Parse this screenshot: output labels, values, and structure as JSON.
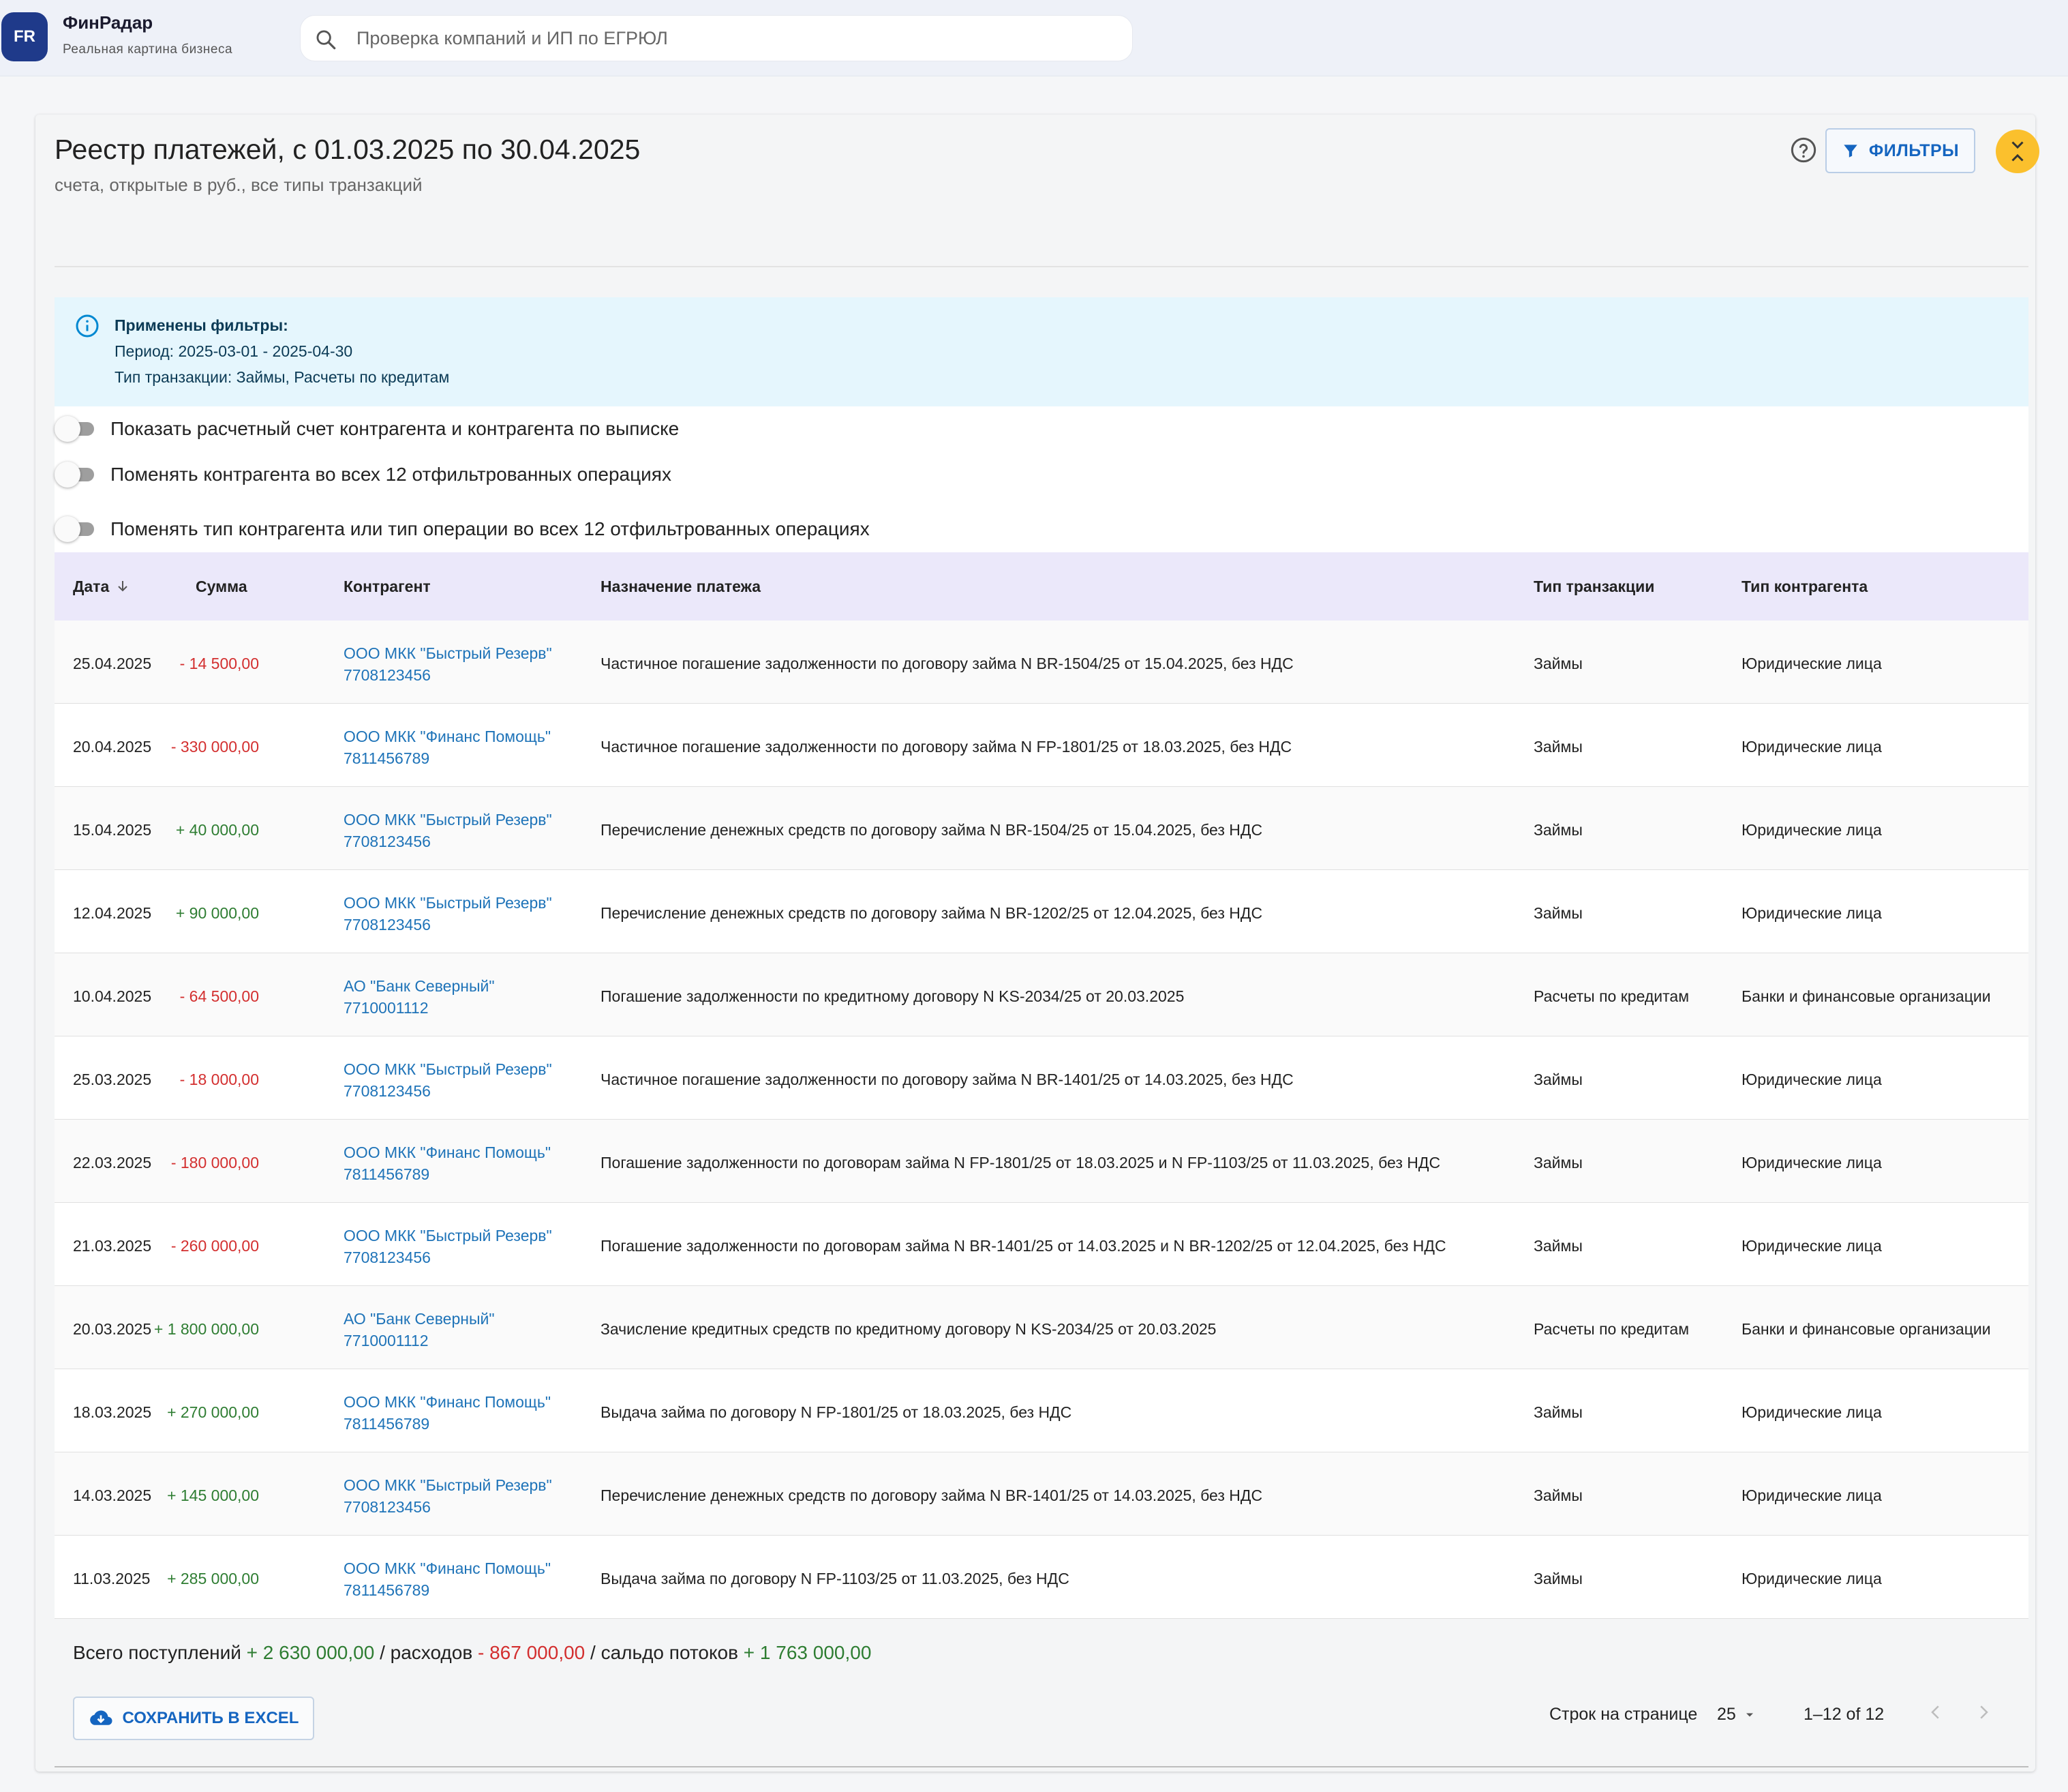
{
  "app": {
    "logo_text": "FR",
    "name": "ФинРадар",
    "tagline": "Реальная картина бизнеса"
  },
  "search": {
    "placeholder": "Проверка компаний и ИП по ЕГРЮЛ",
    "value": ""
  },
  "page": {
    "title": "Реестр платежей, с 01.03.2025 по 30.04.2025",
    "subtitle": "счета, открытые в руб., все типы транзакций",
    "filters_button": "ФИЛЬТРЫ"
  },
  "alert": {
    "title": "Применены фильтры:",
    "period": "Период: 2025-03-01 - 2025-04-30",
    "tx_types": "Тип транзакции: Займы, Расчеты по кредитам"
  },
  "toggles": [
    {
      "label": "Показать расчетный счет контрагента и контрагента по выписке",
      "on": false
    },
    {
      "label": "Поменять контрагента во всех 12 отфильтрованных операциях",
      "on": false
    },
    {
      "label": "Поменять тип контрагента или тип операции во всех 12 отфильтрованных операциях",
      "on": false
    }
  ],
  "table": {
    "columns": [
      "Дата",
      "Сумма",
      "Контрагент",
      "Назначение платежа",
      "Тип транзакции",
      "Тип контрагента"
    ],
    "rows": [
      {
        "date": "25.04.2025",
        "amount": "- 14 500,00",
        "sign": "neg",
        "cp_name": "ООО МКК \"Быстрый Резерв\"",
        "cp_inn": "7708123456",
        "purpose": "Частичное погашение задолженности по договору займа N BR-1504/25 от 15.04.2025, без НДС",
        "tx_type": "Займы",
        "cp_type": "Юридические лица"
      },
      {
        "date": "20.04.2025",
        "amount": "- 330 000,00",
        "sign": "neg",
        "cp_name": "ООО МКК \"Финанс Помощь\"",
        "cp_inn": "7811456789",
        "purpose": "Частичное погашение задолженности по договору займа N FP-1801/25 от 18.03.2025, без НДС",
        "tx_type": "Займы",
        "cp_type": "Юридические лица"
      },
      {
        "date": "15.04.2025",
        "amount": "+ 40 000,00",
        "sign": "pos",
        "cp_name": "ООО МКК \"Быстрый Резерв\"",
        "cp_inn": "7708123456",
        "purpose": "Перечисление денежных средств по договору займа N BR-1504/25 от 15.04.2025, без НДС",
        "tx_type": "Займы",
        "cp_type": "Юридические лица"
      },
      {
        "date": "12.04.2025",
        "amount": "+ 90 000,00",
        "sign": "pos",
        "cp_name": "ООО МКК \"Быстрый Резерв\"",
        "cp_inn": "7708123456",
        "purpose": "Перечисление денежных средств по договору займа N BR-1202/25 от 12.04.2025, без НДС",
        "tx_type": "Займы",
        "cp_type": "Юридические лица"
      },
      {
        "date": "10.04.2025",
        "amount": "- 64 500,00",
        "sign": "neg",
        "cp_name": "АО \"Банк Северный\"",
        "cp_inn": "7710001112",
        "purpose": "Погашение задолженности по кредитному договору N KS-2034/25 от 20.03.2025",
        "tx_type": "Расчеты по кредитам",
        "cp_type": "Банки и финансовые организации"
      },
      {
        "date": "25.03.2025",
        "amount": "- 18 000,00",
        "sign": "neg",
        "cp_name": "ООО МКК \"Быстрый Резерв\"",
        "cp_inn": "7708123456",
        "purpose": "Частичное погашение задолженности по договору займа N BR-1401/25 от 14.03.2025, без НДС",
        "tx_type": "Займы",
        "cp_type": "Юридические лица"
      },
      {
        "date": "22.03.2025",
        "amount": "- 180 000,00",
        "sign": "neg",
        "cp_name": "ООО МКК \"Финанс Помощь\"",
        "cp_inn": "7811456789",
        "purpose": "Погашение задолженности по договорам займа N FP-1801/25 от 18.03.2025 и N FP-1103/25 от 11.03.2025, без НДС",
        "tx_type": "Займы",
        "cp_type": "Юридические лица"
      },
      {
        "date": "21.03.2025",
        "amount": "- 260 000,00",
        "sign": "neg",
        "cp_name": "ООО МКК \"Быстрый Резерв\"",
        "cp_inn": "7708123456",
        "purpose": "Погашение задолженности по договорам займа N BR-1401/25 от 14.03.2025 и N BR-1202/25 от 12.04.2025, без НДС",
        "tx_type": "Займы",
        "cp_type": "Юридические лица"
      },
      {
        "date": "20.03.2025",
        "amount": "+ 1 800 000,00",
        "sign": "pos",
        "cp_name": "АО \"Банк Северный\"",
        "cp_inn": "7710001112",
        "purpose": "Зачисление кредитных средств по кредитному договору N KS-2034/25 от 20.03.2025",
        "tx_type": "Расчеты по кредитам",
        "cp_type": "Банки и финансовые организации"
      },
      {
        "date": "18.03.2025",
        "amount": "+ 270 000,00",
        "sign": "pos",
        "cp_name": "ООО МКК \"Финанс Помощь\"",
        "cp_inn": "7811456789",
        "purpose": "Выдача займа по договору N FP-1801/25 от 18.03.2025, без НДС",
        "tx_type": "Займы",
        "cp_type": "Юридические лица"
      },
      {
        "date": "14.03.2025",
        "amount": "+ 145 000,00",
        "sign": "pos",
        "cp_name": "ООО МКК \"Быстрый Резерв\"",
        "cp_inn": "7708123456",
        "purpose": "Перечисление денежных средств по договору займа N BR-1401/25 от 14.03.2025, без НДС",
        "tx_type": "Займы",
        "cp_type": "Юридические лица"
      },
      {
        "date": "11.03.2025",
        "amount": "+ 285 000,00",
        "sign": "pos",
        "cp_name": "ООО МКК \"Финанс Помощь\"",
        "cp_inn": "7811456789",
        "purpose": "Выдача займа по договору N FP-1103/25 от 11.03.2025, без НДС",
        "tx_type": "Займы",
        "cp_type": "Юридические лица"
      }
    ]
  },
  "totals": {
    "income_label": "Всего поступлений",
    "income": "+ 2 630 000,00",
    "expense_label": "/ расходов",
    "expense": "- 867 000,00",
    "balance_label": "/ сальдо потоков",
    "balance": "+ 1 763 000,00"
  },
  "footer": {
    "save_button": "СОХРАНИТЬ В EXCEL",
    "rows_per_page_label": "Строк на странице",
    "rows_per_page": "25",
    "range": "1–12 of 12"
  },
  "colors": {
    "positive": "#2e7d32",
    "negative": "#d32f2f",
    "link": "#1e73b8",
    "accent": "#1565c0",
    "collapse": "#fbc02d"
  }
}
